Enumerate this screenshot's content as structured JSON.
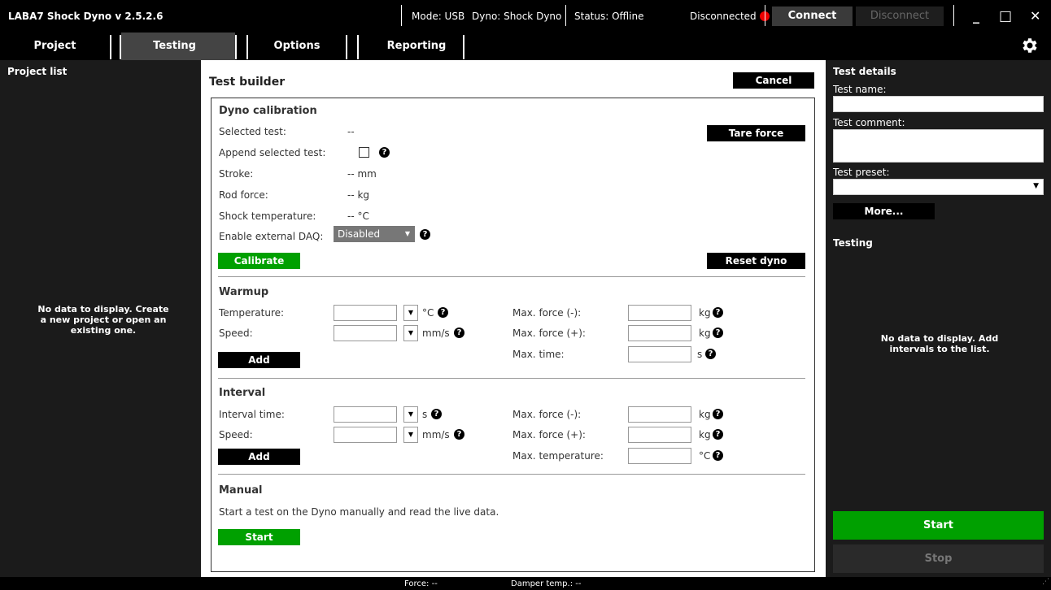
{
  "titlebar": {
    "app_title": "LABA7 Shock Dyno v 2.5.2.6",
    "mode": "Mode: USB",
    "dyno": "Dyno: Shock Dyno",
    "status": "Status: Offline",
    "connection": "Disconnected",
    "connect_label": "Connect",
    "disconnect_label": "Disconnect",
    "minimize_glyph": "_",
    "maximize_glyph": "□",
    "close_glyph": "✕",
    "status_dot_color": "#e00000"
  },
  "nav": {
    "tabs": [
      {
        "label": "Project"
      },
      {
        "label": "Testing"
      },
      {
        "label": "Options"
      },
      {
        "label": "Reporting"
      }
    ],
    "active_tab": "Testing",
    "settings_icon": "gear-icon"
  },
  "left_panel": {
    "title": "Project list",
    "empty_message": "No data to display. Create a new project or open an existing one."
  },
  "builder": {
    "title": "Test builder",
    "cancel_label": "Cancel",
    "calibration": {
      "heading": "Dyno calibration",
      "selected_test_label": "Selected test:",
      "selected_test_value": "--",
      "append_label": "Append selected test:",
      "stroke_label": "Stroke:",
      "stroke_value": "-- mm",
      "rod_force_label": "Rod force:",
      "rod_force_value": "-- kg",
      "shock_temp_label": "Shock temperature:",
      "shock_temp_value": "-- °C",
      "external_daq_label": "Enable external DAQ:",
      "external_daq_value": "Disabled",
      "tare_label": "Tare force",
      "calibrate_label": "Calibrate",
      "reset_label": "Reset dyno"
    },
    "warmup": {
      "heading": "Warmup",
      "temperature_label": "Temperature:",
      "temperature_unit": "°C",
      "speed_label": "Speed:",
      "speed_unit": "mm/s",
      "max_force_neg_label": "Max. force (-):",
      "max_force_neg_unit": "kg",
      "max_force_pos_label": "Max. force (+):",
      "max_force_pos_unit": "kg",
      "max_time_label": "Max. time:",
      "max_time_unit": "s",
      "add_label": "Add"
    },
    "interval": {
      "heading": "Interval",
      "interval_time_label": "Interval time:",
      "interval_time_unit": "s",
      "speed_label": "Speed:",
      "speed_unit": "mm/s",
      "max_force_neg_label": "Max. force (-):",
      "max_force_neg_unit": "kg",
      "max_force_pos_label": "Max. force (+):",
      "max_force_pos_unit": "kg",
      "max_temp_label": "Max. temperature:",
      "max_temp_unit": "°C",
      "add_label": "Add"
    },
    "manual": {
      "heading": "Manual",
      "description": "Start a test on the Dyno manually and read the live data.",
      "start_label": "Start"
    }
  },
  "right_panel": {
    "details_title": "Test details",
    "test_name_label": "Test name:",
    "test_comment_label": "Test comment:",
    "test_preset_label": "Test preset:",
    "more_label": "More...",
    "testing_title": "Testing",
    "empty_message": "No data to display. Add intervals to the list.",
    "start_label": "Start",
    "stop_label": "Stop"
  },
  "statusbar": {
    "force": "Force:  --",
    "damper_temp": "Damper temp.:  --"
  }
}
